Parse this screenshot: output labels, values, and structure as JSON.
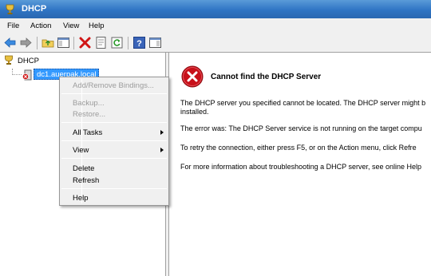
{
  "window": {
    "title": "DHCP"
  },
  "menu": [
    "File",
    "Action",
    "View",
    "Help"
  ],
  "toolbar": {
    "icons": [
      "back-arrow-icon",
      "forward-arrow-icon",
      "up-folder-icon",
      "show-hide-tree-icon",
      "delete-icon",
      "properties-icon",
      "refresh-icon",
      "help-icon",
      "show-hide-action-pane-icon"
    ]
  },
  "tree": {
    "root_label": "DHCP",
    "server_label": "dc1.auerpak.local"
  },
  "context_menu": {
    "items": [
      {
        "label": "Add/Remove Bindings...",
        "enabled": false
      },
      {
        "label": "Backup...",
        "enabled": false
      },
      {
        "label": "Restore...",
        "enabled": false
      },
      {
        "label": "All Tasks",
        "enabled": true,
        "submenu": true
      },
      {
        "label": "View",
        "enabled": true,
        "submenu": true
      },
      {
        "label": "Delete",
        "enabled": true
      },
      {
        "label": "Refresh",
        "enabled": true
      },
      {
        "label": "Help",
        "enabled": true
      }
    ]
  },
  "detail": {
    "title": "Cannot find the DHCP Server",
    "line1": "The DHCP server you specified cannot be located. The DHCP server might b",
    "line2": "installed.",
    "line3": "The error was:  The DHCP Server service is not running on the target compu",
    "line4": "To retry the connection, either press F5, or on the Action menu, click Refre",
    "line5": "For more information about troubleshooting a DHCP server, see online Help"
  },
  "colors": {
    "titlebar": "#2f74c4",
    "selection": "#3399ff",
    "error_red": "#c8101a"
  }
}
